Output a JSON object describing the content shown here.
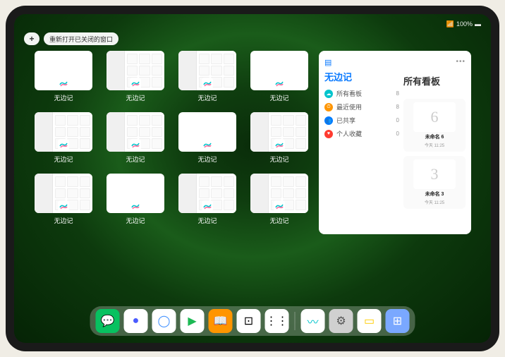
{
  "status": {
    "battery_text": "100%",
    "signal": "📶"
  },
  "controls": {
    "plus": "+",
    "reopen_label": "重新打开已关闭的窗口"
  },
  "app_name": "无边记",
  "windows": [
    {
      "label": "无边记",
      "variant": "blank"
    },
    {
      "label": "无边记",
      "variant": "detailed"
    },
    {
      "label": "无边记",
      "variant": "detailed"
    },
    {
      "label": "无边记",
      "variant": "blank"
    },
    {
      "label": "无边记",
      "variant": "detailed"
    },
    {
      "label": "无边记",
      "variant": "detailed"
    },
    {
      "label": "无边记",
      "variant": "blank"
    },
    {
      "label": "无边记",
      "variant": "detailed"
    },
    {
      "label": "无边记",
      "variant": "detailed"
    },
    {
      "label": "无边记",
      "variant": "blank"
    },
    {
      "label": "无边记",
      "variant": "detailed"
    },
    {
      "label": "无边记",
      "variant": "detailed"
    }
  ],
  "panel": {
    "left_title": "无边记",
    "right_title": "所有看板",
    "categories": [
      {
        "icon": "cyan",
        "glyph": "☁",
        "label": "所有看板",
        "count": "8"
      },
      {
        "icon": "orange",
        "glyph": "⏱",
        "label": "最近使用",
        "count": "8"
      },
      {
        "icon": "blue",
        "glyph": "👥",
        "label": "已共享",
        "count": "0"
      },
      {
        "icon": "red",
        "glyph": "♥",
        "label": "个人收藏",
        "count": "0"
      }
    ],
    "boards": [
      {
        "sketch": "6",
        "name": "未命名 6",
        "date": "今天 11:25"
      },
      {
        "sketch": "3",
        "name": "未命名 3",
        "date": "今天 11:25"
      }
    ]
  },
  "dock": [
    {
      "name": "wechat",
      "bg": "#07c160",
      "glyph": "💬"
    },
    {
      "name": "quark",
      "bg": "#ffffff",
      "glyph": "●",
      "fg": "#4a5bff"
    },
    {
      "name": "browser",
      "bg": "#ffffff",
      "glyph": "◯",
      "fg": "#3a8dff"
    },
    {
      "name": "app4",
      "bg": "#ffffff",
      "glyph": "▶",
      "fg": "#1db954"
    },
    {
      "name": "books",
      "bg": "#ff9500",
      "glyph": "📖"
    },
    {
      "name": "app6",
      "bg": "#ffffff",
      "glyph": "⊡",
      "fg": "#000"
    },
    {
      "name": "app7",
      "bg": "#ffffff",
      "glyph": "⋮⋮",
      "fg": "#000"
    },
    {
      "name": "separator"
    },
    {
      "name": "freeform",
      "bg": "#ffffff",
      "glyph": "〰",
      "fg": "#00c4cc"
    },
    {
      "name": "settings",
      "bg": "#d0d0d0",
      "glyph": "⚙",
      "fg": "#555"
    },
    {
      "name": "notes",
      "bg": "#fff",
      "glyph": "▭",
      "fg": "#ffcc00"
    },
    {
      "name": "recent",
      "bg": "#7aa8ff",
      "glyph": "⊞"
    }
  ]
}
